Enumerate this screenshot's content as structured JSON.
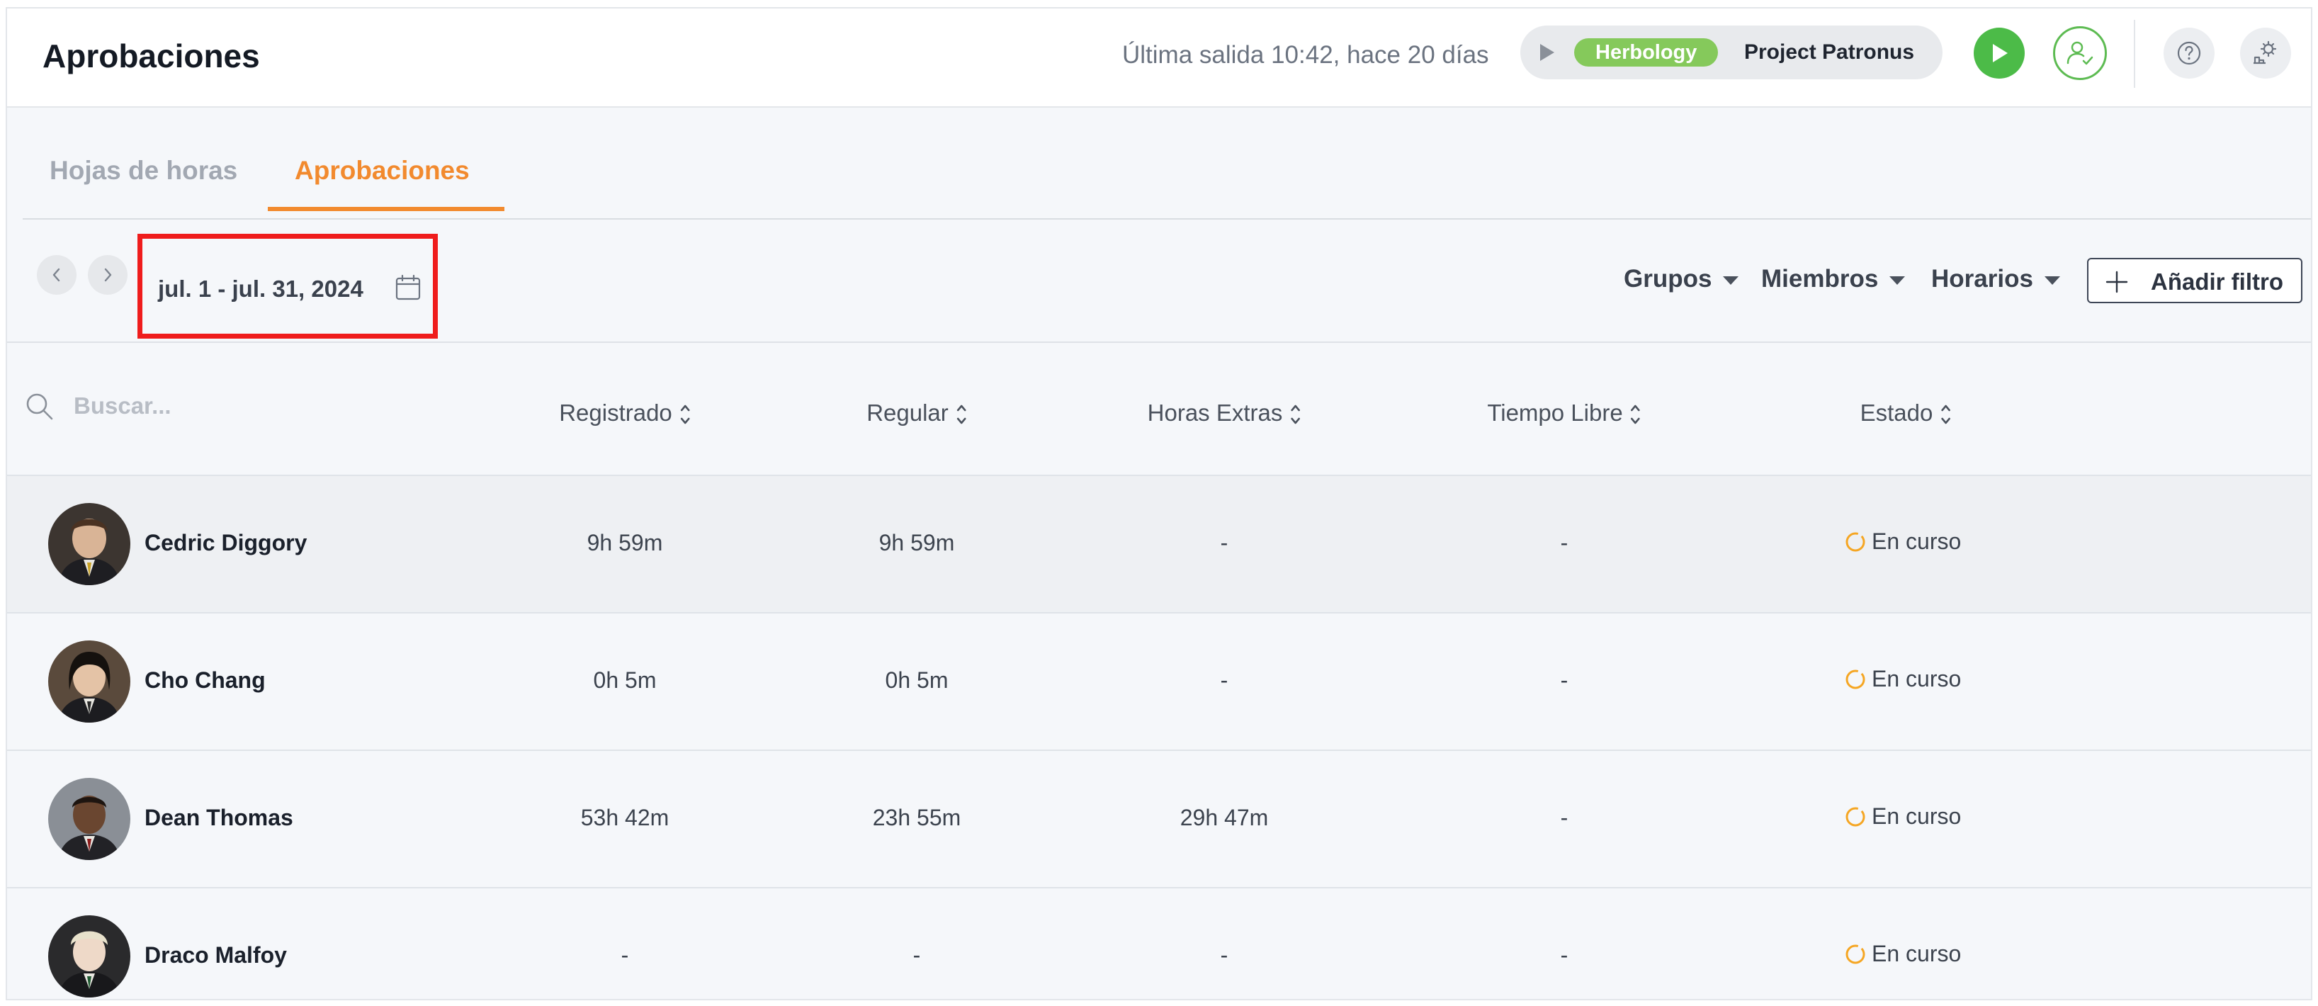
{
  "header": {
    "title": "Aprobaciones",
    "last_out": "Última salida 10:42, hace 20 días",
    "timer": {
      "tag": "Herbology",
      "tag_color": "#85c95b",
      "project": "Project Patronus"
    }
  },
  "tabs": [
    {
      "label": "Hojas de horas",
      "active": false
    },
    {
      "label": "Aprobaciones",
      "active": true
    }
  ],
  "filters": {
    "date_range": "jul. 1 - jul. 31, 2024",
    "groups": "Grupos",
    "members": "Miembros",
    "schedules": "Horarios",
    "add_filter": "Añadir filtro"
  },
  "search": {
    "placeholder": "Buscar..."
  },
  "columns": [
    "Registrado",
    "Regular",
    "Horas Extras",
    "Tiempo Libre",
    "Estado"
  ],
  "rows": [
    {
      "name": "Cedric Diggory",
      "registrado": "9h 59m",
      "regular": "9h 59m",
      "extras": "-",
      "libre": "-",
      "estado": "En curso"
    },
    {
      "name": "Cho Chang",
      "registrado": "0h 5m",
      "regular": "0h 5m",
      "extras": "-",
      "libre": "-",
      "estado": "En curso"
    },
    {
      "name": "Dean Thomas",
      "registrado": "53h 42m",
      "regular": "23h 55m",
      "extras": "29h 47m",
      "libre": "-",
      "estado": "En curso"
    },
    {
      "name": "Draco Malfoy",
      "registrado": "-",
      "regular": "-",
      "extras": "-",
      "libre": "-",
      "estado": "En curso"
    }
  ],
  "colors": {
    "accent": "#f28a2e",
    "start_button": "#4cbb48",
    "status_in_progress": "#f5a623",
    "highlight_border": "#ef1c1c"
  }
}
